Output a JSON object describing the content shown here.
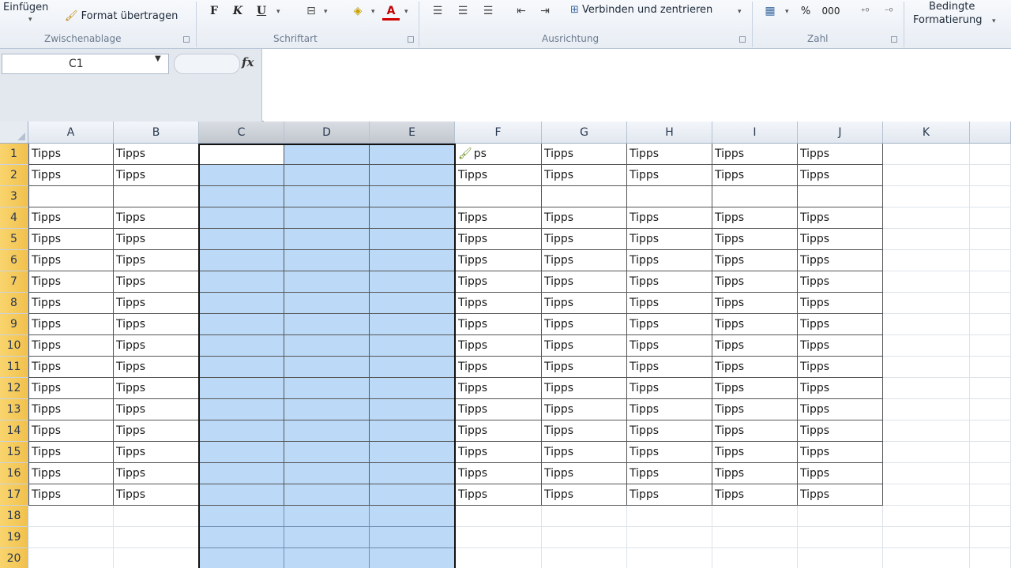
{
  "ribbon": {
    "clipboard": {
      "paste_label": "Einfügen",
      "format_painter_label": "Format übertragen",
      "group_label": "Zwischenablage"
    },
    "font": {
      "bold": "F",
      "italic": "K",
      "underline": "U",
      "font_color_letter": "A",
      "group_label": "Schriftart"
    },
    "alignment": {
      "merge_label": "Verbinden und zentrieren",
      "group_label": "Ausrichtung"
    },
    "number": {
      "percent": "%",
      "thousands": "000",
      "group_label": "Zahl"
    },
    "styles": {
      "conditional_line1": "Bedingte",
      "conditional_line2": "Formatierung"
    }
  },
  "formula_bar": {
    "name_box_value": "C1",
    "fx_label": "fx",
    "formula_value": ""
  },
  "sheet": {
    "columns": [
      "A",
      "B",
      "C",
      "D",
      "E",
      "F",
      "G",
      "H",
      "I",
      "J",
      "K"
    ],
    "selected_columns": [
      "C",
      "D",
      "E"
    ],
    "active_cell": "C1",
    "rows": [
      {
        "n": "1",
        "cells": [
          "Tipps",
          "Tipps",
          "",
          "",
          "",
          "ps",
          "Tipps",
          "Tipps",
          "Tipps",
          "Tipps",
          ""
        ]
      },
      {
        "n": "2",
        "cells": [
          "Tipps",
          "Tipps",
          "",
          "",
          "",
          "Tipps",
          "Tipps",
          "Tipps",
          "Tipps",
          "Tipps",
          ""
        ]
      },
      {
        "n": "3",
        "cells": [
          "",
          "",
          "",
          "",
          "",
          "",
          "",
          "",
          "",
          "",
          ""
        ]
      },
      {
        "n": "4",
        "cells": [
          "Tipps",
          "Tipps",
          "",
          "",
          "",
          "Tipps",
          "Tipps",
          "Tipps",
          "Tipps",
          "Tipps",
          ""
        ]
      },
      {
        "n": "5",
        "cells": [
          "Tipps",
          "Tipps",
          "",
          "",
          "",
          "Tipps",
          "Tipps",
          "Tipps",
          "Tipps",
          "Tipps",
          ""
        ]
      },
      {
        "n": "6",
        "cells": [
          "Tipps",
          "Tipps",
          "",
          "",
          "",
          "Tipps",
          "Tipps",
          "Tipps",
          "Tipps",
          "Tipps",
          ""
        ]
      },
      {
        "n": "7",
        "cells": [
          "Tipps",
          "Tipps",
          "",
          "",
          "",
          "Tipps",
          "Tipps",
          "Tipps",
          "Tipps",
          "Tipps",
          ""
        ]
      },
      {
        "n": "8",
        "cells": [
          "Tipps",
          "Tipps",
          "",
          "",
          "",
          "Tipps",
          "Tipps",
          "Tipps",
          "Tipps",
          "Tipps",
          ""
        ]
      },
      {
        "n": "9",
        "cells": [
          "Tipps",
          "Tipps",
          "",
          "",
          "",
          "Tipps",
          "Tipps",
          "Tipps",
          "Tipps",
          "Tipps",
          ""
        ]
      },
      {
        "n": "10",
        "cells": [
          "Tipps",
          "Tipps",
          "",
          "",
          "",
          "Tipps",
          "Tipps",
          "Tipps",
          "Tipps",
          "Tipps",
          ""
        ]
      },
      {
        "n": "11",
        "cells": [
          "Tipps",
          "Tipps",
          "",
          "",
          "",
          "Tipps",
          "Tipps",
          "Tipps",
          "Tipps",
          "Tipps",
          ""
        ]
      },
      {
        "n": "12",
        "cells": [
          "Tipps",
          "Tipps",
          "",
          "",
          "",
          "Tipps",
          "Tipps",
          "Tipps",
          "Tipps",
          "Tipps",
          ""
        ]
      },
      {
        "n": "13",
        "cells": [
          "Tipps",
          "Tipps",
          "",
          "",
          "",
          "Tipps",
          "Tipps",
          "Tipps",
          "Tipps",
          "Tipps",
          ""
        ]
      },
      {
        "n": "14",
        "cells": [
          "Tipps",
          "Tipps",
          "",
          "",
          "",
          "Tipps",
          "Tipps",
          "Tipps",
          "Tipps",
          "Tipps",
          ""
        ]
      },
      {
        "n": "15",
        "cells": [
          "Tipps",
          "Tipps",
          "",
          "",
          "",
          "Tipps",
          "Tipps",
          "Tipps",
          "Tipps",
          "Tipps",
          ""
        ]
      },
      {
        "n": "16",
        "cells": [
          "Tipps",
          "Tipps",
          "",
          "",
          "",
          "Tipps",
          "Tipps",
          "Tipps",
          "Tipps",
          "Tipps",
          ""
        ]
      },
      {
        "n": "17",
        "cells": [
          "Tipps",
          "Tipps",
          "",
          "",
          "",
          "Tipps",
          "Tipps",
          "Tipps",
          "Tipps",
          "Tipps",
          ""
        ]
      },
      {
        "n": "18",
        "cells": [
          "",
          "",
          "",
          "",
          "",
          "",
          "",
          "",
          "",
          "",
          ""
        ]
      },
      {
        "n": "19",
        "cells": [
          "",
          "",
          "",
          "",
          "",
          "",
          "",
          "",
          "",
          "",
          ""
        ]
      },
      {
        "n": "20",
        "cells": [
          "",
          "",
          "",
          "",
          "",
          "",
          "",
          "",
          "",
          "",
          ""
        ]
      }
    ],
    "colors": {
      "selection_fill": "#bcdaf7",
      "row_header_fill": "#f1c14e"
    }
  }
}
